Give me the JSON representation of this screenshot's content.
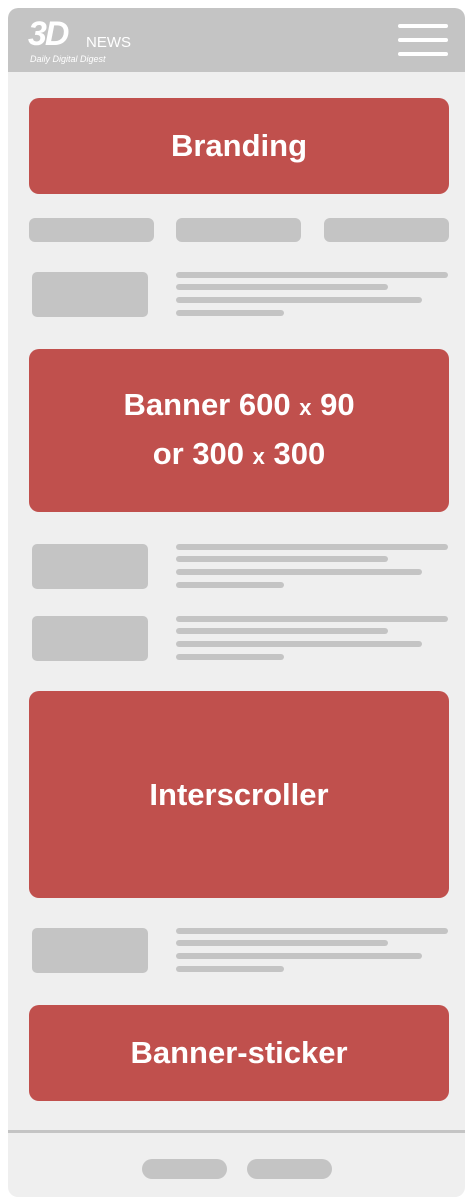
{
  "header": {
    "logo_main": "3D",
    "logo_news": "NEWS",
    "logo_tagline": "Daily Digital Digest",
    "menu_icon": "hamburger-menu-icon"
  },
  "ads": {
    "branding": "Branding",
    "banner_line1_a": "Banner 600",
    "banner_x1": "x",
    "banner_line1_b": "90",
    "banner_line2_a": "or 300",
    "banner_x2": "x",
    "banner_line2_b": "300",
    "interscroller": "Interscroller",
    "sticker": "Banner-sticker"
  },
  "colors": {
    "ad_red": "#c0504d",
    "placeholder_gray": "#c4c4c4",
    "background": "#efefef"
  }
}
